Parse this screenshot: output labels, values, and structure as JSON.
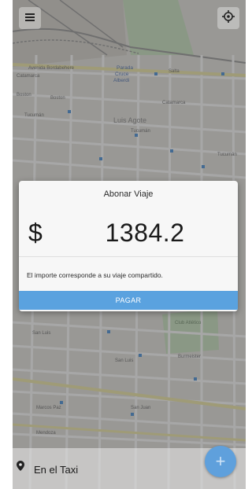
{
  "map": {
    "streets": [
      "Avenida Bordabehere",
      "Salta",
      "Catamarca",
      "Boston",
      "Tucumán",
      "Aaron Castellanos",
      "Alsina",
      "Iriondo",
      "San Nicolás",
      "Cafferata",
      "Buenos Aires",
      "Mendoza",
      "Marcos Paz",
      "San Juan",
      "San Luis",
      "Burmeister",
      "Crespo",
      "Santa Fe"
    ],
    "places": [
      "Parada Cruce Alberdi",
      "Luis Agote",
      "Club Atlético del Rosario"
    ]
  },
  "toolbar": {
    "menu_icon": "hamburger-menu-icon",
    "locate_icon": "crosshair-location-icon"
  },
  "dialog": {
    "title": "Abonar Viaje",
    "currency_symbol": "$",
    "amount": "1384.2",
    "message": "El importe corresponde a su viaje compartido.",
    "pay_label": "PAGAR",
    "accent_color": "#5aa2df"
  },
  "status": {
    "icon": "location-pin-icon",
    "label": "En el Taxi"
  },
  "fab": {
    "icon": "plus-icon",
    "label": "+"
  }
}
